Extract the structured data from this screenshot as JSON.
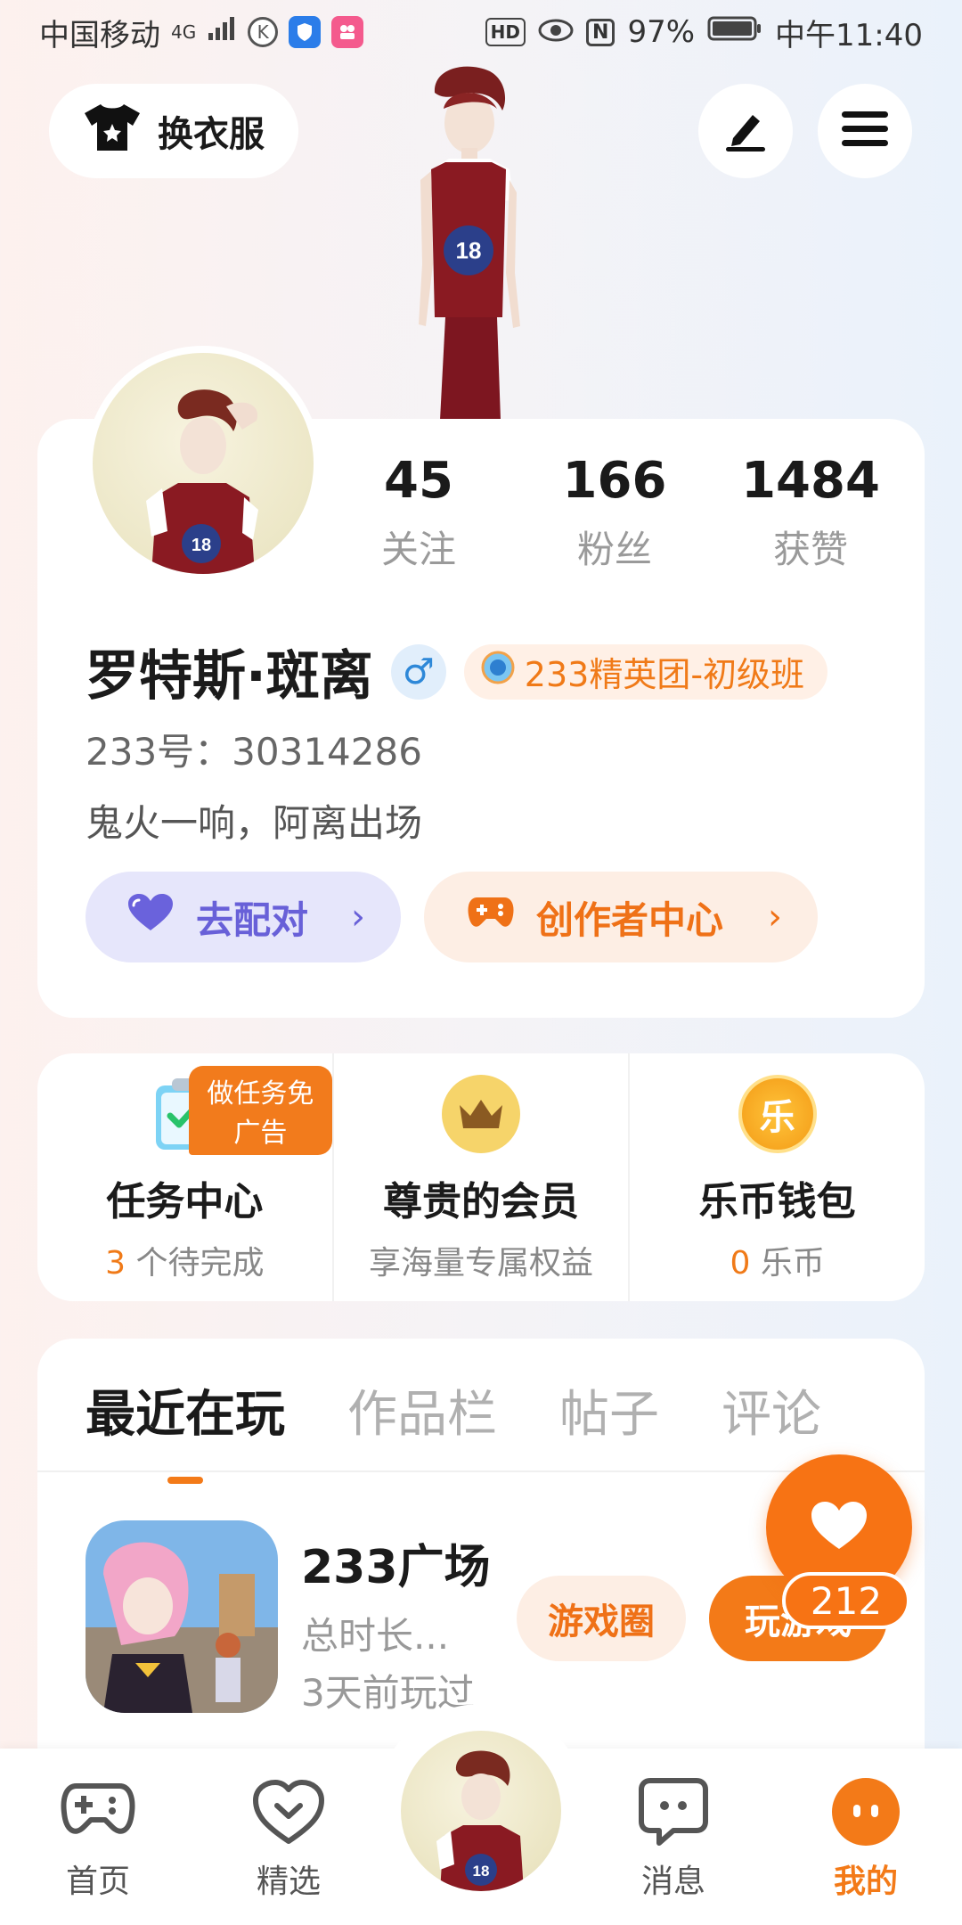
{
  "status_bar": {
    "carrier": "中国移动",
    "network": "4G",
    "battery": "97%",
    "time": "中午11:40",
    "hd": "HD",
    "nfc": "N"
  },
  "header": {
    "dress_label": "换衣服"
  },
  "profile": {
    "stats": [
      {
        "value": "45",
        "label": "关注"
      },
      {
        "value": "166",
        "label": "粉丝"
      },
      {
        "value": "1484",
        "label": "获赞"
      }
    ],
    "name": "罗特斯·斑离",
    "gender_symbol": "♂",
    "badge": "233精英团-初级班",
    "id_line": "233号：30314286",
    "bio": "鬼火一响，阿离出场",
    "match_button": "去配对",
    "creator_button": "创作者中心"
  },
  "quick": {
    "ad_tag": "做任务免广告",
    "items": [
      {
        "title": "任务中心",
        "highlight": "3",
        "sub": " 个待完成"
      },
      {
        "title": "尊贵的会员",
        "highlight": "",
        "sub": "享海量专属权益"
      },
      {
        "title": "乐币钱包",
        "highlight": "0",
        "sub": " 乐币"
      }
    ],
    "wallet_glyph": "乐"
  },
  "tabs": [
    "最近在玩",
    "作品栏",
    "帖子",
    "评论"
  ],
  "recent_game": {
    "name": "233广场",
    "playtime": "总时长...",
    "last_played": "3天前玩过",
    "circle_button": "游戏圈",
    "play_button": "玩游戏"
  },
  "like_count": "212",
  "nav": [
    "首页",
    "精选",
    "消息",
    "我的"
  ],
  "colors": {
    "accent": "#f37a18",
    "match": "#6860d8",
    "gender": "#2e88d8"
  }
}
